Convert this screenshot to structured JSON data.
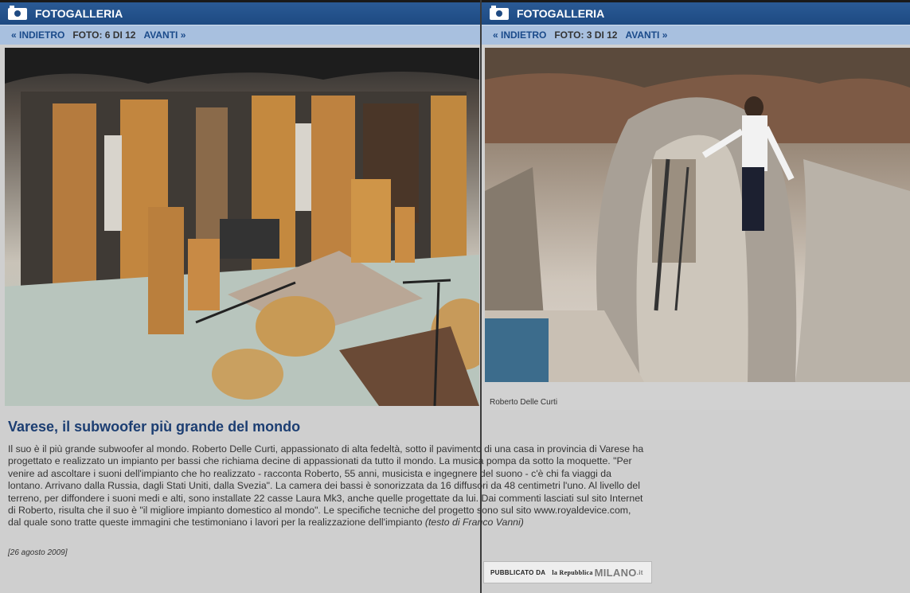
{
  "left": {
    "header_title": "FOTOGALLERIA",
    "nav": {
      "prev": "« INDIETRO",
      "count": "FOTO: 6 DI 12",
      "next": "AVANTI »"
    }
  },
  "right": {
    "header_title": "FOTOGALLERIA",
    "nav": {
      "prev": "« INDIETRO",
      "count": "FOTO: 3 DI 12",
      "next": "AVANTI »"
    },
    "caption": "Roberto Delle Curti"
  },
  "article": {
    "title": "Varese, il subwoofer più grande del mondo",
    "body": "Il suo è il più grande subwoofer al mondo. Roberto Delle Curti, appassionato di alta fedeltà, sotto il pavimento di una casa in provincia di Varese ha progettato e realizzato un impianto per bassi che richiama decine di appassionati da tutto il mondo. La musica pompa da sotto la moquette. \"Per venire ad ascoltare i suoni dell'impianto che ho realizzato - racconta Roberto, 55 anni, musicista e ingegnere del suono - c'è chi fa viaggi da lontano. Arrivano dalla Russia, dagli Stati Uniti, dalla Svezia\". La camera dei bassi è sonorizzata da 16 diffusori da 48 centimetri l'uno. Al livello del terreno, per diffondere i suoni medi e alti, sono installate 22 casse Laura Mk3, anche quelle progettate da lui. Dai commenti lasciati sul sito Internet di Roberto, risulta che il suo è \"il migliore impianto domestico al mondo\". Le specifiche tecniche del progetto sono sul sito www.royaldevice.com, dal quale sono tratte queste immagini che testimoniano i lavori per la realizzazione dell'impianto",
    "author": "(testo di Franco Vanni)",
    "date": "[26 agosto 2009]"
  },
  "published": {
    "label": "PUBBLICATO DA",
    "brand": "la Repubblica",
    "city": "MILANO",
    "tld": ".it"
  }
}
